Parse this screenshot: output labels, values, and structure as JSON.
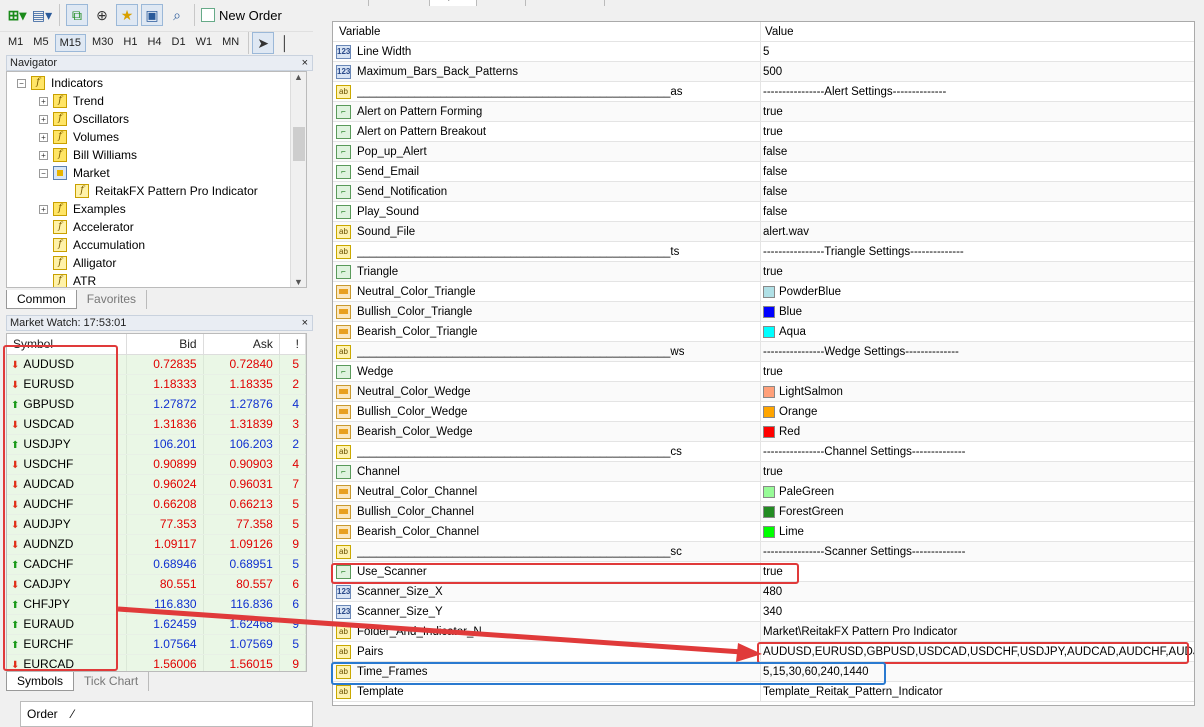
{
  "toolbar": {
    "new_order_label": "New Order",
    "timeframes": [
      "M1",
      "M5",
      "M15",
      "M30",
      "H1",
      "H4",
      "D1",
      "W1",
      "MN"
    ],
    "active_timeframe": "M15"
  },
  "navigator": {
    "title": "Navigator",
    "close": "×",
    "items": [
      {
        "label": "Indicators",
        "level": 0,
        "expander": "−",
        "icon": "folder-function-icon"
      },
      {
        "label": "Trend",
        "level": 1,
        "expander": "+",
        "icon": "folder-function-icon"
      },
      {
        "label": "Oscillators",
        "level": 1,
        "expander": "+",
        "icon": "folder-function-icon"
      },
      {
        "label": "Volumes",
        "level": 1,
        "expander": "+",
        "icon": "folder-function-icon"
      },
      {
        "label": "Bill Williams",
        "level": 1,
        "expander": "+",
        "icon": "folder-function-icon"
      },
      {
        "label": "Market",
        "level": 1,
        "expander": "−",
        "icon": "market-icon"
      },
      {
        "label": "ReitakFX Pattern Pro Indicator",
        "level": 2,
        "expander": "",
        "icon": "indicator-icon"
      },
      {
        "label": "Examples",
        "level": 1,
        "expander": "+",
        "icon": "folder-function-icon"
      },
      {
        "label": "Accelerator",
        "level": 1,
        "expander": "",
        "icon": "indicator-icon"
      },
      {
        "label": "Accumulation",
        "level": 1,
        "expander": "",
        "icon": "indicator-icon"
      },
      {
        "label": "Alligator",
        "level": 1,
        "expander": "",
        "icon": "indicator-icon"
      },
      {
        "label": "ATR",
        "level": 1,
        "expander": "",
        "icon": "indicator-icon"
      }
    ],
    "tabs": [
      "Common",
      "Favorites"
    ]
  },
  "market_watch": {
    "title": "Market Watch: 17:53:01",
    "columns": [
      "Symbol",
      "Bid",
      "Ask",
      "!"
    ],
    "rows": [
      {
        "symbol": "AUDUSD",
        "dir": "down",
        "bid": "0.72835",
        "ask": "0.72840",
        "spread": "5",
        "color": "red"
      },
      {
        "symbol": "EURUSD",
        "dir": "down",
        "bid": "1.18333",
        "ask": "1.18335",
        "spread": "2",
        "color": "red"
      },
      {
        "symbol": "GBPUSD",
        "dir": "up",
        "bid": "1.27872",
        "ask": "1.27876",
        "spread": "4",
        "color": "blue"
      },
      {
        "symbol": "USDCAD",
        "dir": "down",
        "bid": "1.31836",
        "ask": "1.31839",
        "spread": "3",
        "color": "red"
      },
      {
        "symbol": "USDJPY",
        "dir": "up",
        "bid": "106.201",
        "ask": "106.203",
        "spread": "2",
        "color": "blue"
      },
      {
        "symbol": "USDCHF",
        "dir": "down",
        "bid": "0.90899",
        "ask": "0.90903",
        "spread": "4",
        "color": "red"
      },
      {
        "symbol": "AUDCAD",
        "dir": "down",
        "bid": "0.96024",
        "ask": "0.96031",
        "spread": "7",
        "color": "red"
      },
      {
        "symbol": "AUDCHF",
        "dir": "down",
        "bid": "0.66208",
        "ask": "0.66213",
        "spread": "5",
        "color": "red"
      },
      {
        "symbol": "AUDJPY",
        "dir": "down",
        "bid": "77.353",
        "ask": "77.358",
        "spread": "5",
        "color": "red"
      },
      {
        "symbol": "AUDNZD",
        "dir": "down",
        "bid": "1.09117",
        "ask": "1.09126",
        "spread": "9",
        "color": "red"
      },
      {
        "symbol": "CADCHF",
        "dir": "up",
        "bid": "0.68946",
        "ask": "0.68951",
        "spread": "5",
        "color": "blue"
      },
      {
        "symbol": "CADJPY",
        "dir": "down",
        "bid": "80.551",
        "ask": "80.557",
        "spread": "6",
        "color": "red"
      },
      {
        "symbol": "CHFJPY",
        "dir": "up",
        "bid": "116.830",
        "ask": "116.836",
        "spread": "6",
        "color": "blue"
      },
      {
        "symbol": "EURAUD",
        "dir": "up",
        "bid": "1.62459",
        "ask": "1.62468",
        "spread": "9",
        "color": "blue"
      },
      {
        "symbol": "EURCHF",
        "dir": "up",
        "bid": "1.07564",
        "ask": "1.07569",
        "spread": "5",
        "color": "blue"
      },
      {
        "symbol": "EURCAD",
        "dir": "down",
        "bid": "1.56006",
        "ask": "1.56015",
        "spread": "9",
        "color": "red"
      }
    ],
    "tabs": [
      "Symbols",
      "Tick Chart"
    ]
  },
  "order_box": {
    "label": "Order",
    "sep": "⁄"
  },
  "properties": {
    "tabs": [
      "About",
      "Common",
      "Inputs",
      "Colors",
      "Visualization"
    ],
    "active_tab": "Inputs",
    "header": {
      "variable": "Variable",
      "value": "Value"
    },
    "rows": [
      {
        "type": "num",
        "name": "Line Width",
        "value": "5"
      },
      {
        "type": "num",
        "name": "Maximum_Bars_Back_Patterns",
        "value": "500"
      },
      {
        "type": "ab",
        "name": "_________________________________________________as",
        "value": "----------------Alert Settings--------------"
      },
      {
        "type": "bool",
        "name": "Alert on Pattern Forming",
        "value": "true"
      },
      {
        "type": "bool",
        "name": "Alert on Pattern Breakout",
        "value": "true"
      },
      {
        "type": "bool",
        "name": "Pop_up_Alert",
        "value": "false"
      },
      {
        "type": "bool",
        "name": "Send_Email",
        "value": "false"
      },
      {
        "type": "bool",
        "name": "Send_Notification",
        "value": "false"
      },
      {
        "type": "bool",
        "name": "Play_Sound",
        "value": "false"
      },
      {
        "type": "ab",
        "name": "Sound_File",
        "value": "alert.wav"
      },
      {
        "type": "ab",
        "name": "_________________________________________________ts",
        "value": "----------------Triangle Settings--------------"
      },
      {
        "type": "bool",
        "name": "Triangle",
        "value": "true"
      },
      {
        "type": "col",
        "name": "Neutral_Color_Triangle",
        "value": "PowderBlue",
        "swatch": "#b0e0e6"
      },
      {
        "type": "col",
        "name": "Bullish_Color_Triangle",
        "value": "Blue",
        "swatch": "#0000ff"
      },
      {
        "type": "col",
        "name": "Bearish_Color_Triangle",
        "value": "Aqua",
        "swatch": "#00ffff"
      },
      {
        "type": "ab",
        "name": "_________________________________________________ws",
        "value": "----------------Wedge Settings--------------"
      },
      {
        "type": "bool",
        "name": "Wedge",
        "value": "true"
      },
      {
        "type": "col",
        "name": "Neutral_Color_Wedge",
        "value": "LightSalmon",
        "swatch": "#ffa07a"
      },
      {
        "type": "col",
        "name": "Bullish_Color_Wedge",
        "value": "Orange",
        "swatch": "#ffa500"
      },
      {
        "type": "col",
        "name": "Bearish_Color_Wedge",
        "value": "Red",
        "swatch": "#ff0000"
      },
      {
        "type": "ab",
        "name": "_________________________________________________cs",
        "value": "----------------Channel Settings--------------"
      },
      {
        "type": "bool",
        "name": "Channel",
        "value": "true"
      },
      {
        "type": "col",
        "name": "Neutral_Color_Channel",
        "value": "PaleGreen",
        "swatch": "#98fb98"
      },
      {
        "type": "col",
        "name": "Bullish_Color_Channel",
        "value": "ForestGreen",
        "swatch": "#228b22"
      },
      {
        "type": "col",
        "name": "Bearish_Color_Channel",
        "value": "Lime",
        "swatch": "#00ff00"
      },
      {
        "type": "ab",
        "name": "_________________________________________________sc",
        "value": "----------------Scanner Settings--------------"
      },
      {
        "type": "bool",
        "name": "Use_Scanner",
        "value": "true"
      },
      {
        "type": "num",
        "name": "Scanner_Size_X",
        "value": "480"
      },
      {
        "type": "num",
        "name": "Scanner_Size_Y",
        "value": "340"
      },
      {
        "type": "ab",
        "name": "Folder_And_Indicator_N...",
        "value": "Market\\ReitakFX Pattern Pro Indicator"
      },
      {
        "type": "ab",
        "name": "Pairs",
        "value": "AUDUSD,EURUSD,GBPUSD,USDCAD,USDCHF,USDJPY,AUDCAD,AUDCHF,AUDJ..."
      },
      {
        "type": "ab",
        "name": "Time_Frames",
        "value": "5,15,30,60,240,1440"
      },
      {
        "type": "ab",
        "name": "Template",
        "value": "Template_Reitak_Pattern_Indicator"
      }
    ]
  },
  "annotation_colors": {
    "red": "#e03a3a",
    "blue": "#2a7ad0"
  }
}
